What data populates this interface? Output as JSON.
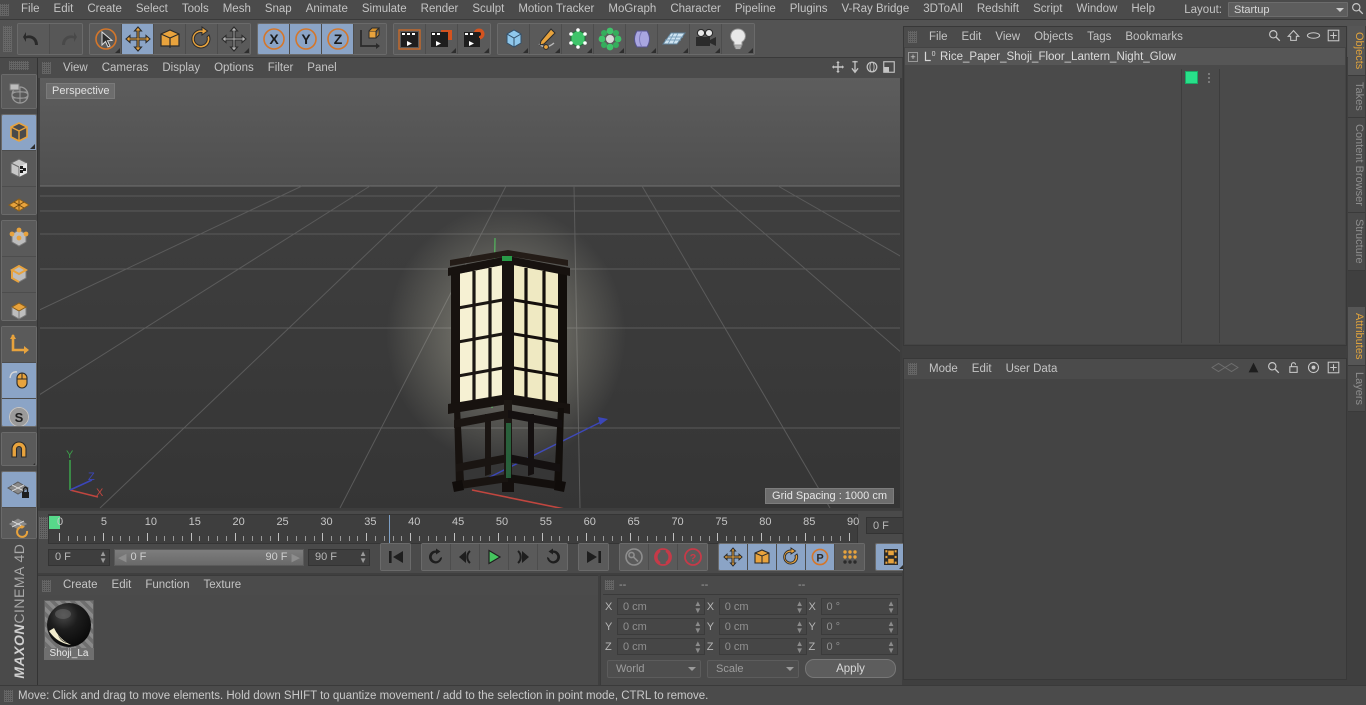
{
  "app": {
    "brand_bold": "MAXON",
    "brand_light": "CINEMA 4D"
  },
  "menubar": {
    "items": [
      "File",
      "Edit",
      "Create",
      "Select",
      "Tools",
      "Mesh",
      "Snap",
      "Animate",
      "Simulate",
      "Render",
      "Sculpt",
      "Motion Tracker",
      "MoGraph",
      "Character",
      "Pipeline",
      "Plugins",
      "V-Ray Bridge",
      "3DToAll",
      "Redshift",
      "Script",
      "Window",
      "Help"
    ],
    "layout_label": "Layout:",
    "layout_value": "Startup",
    "search_icon": "search-icon"
  },
  "toolbar": {
    "groups": [
      {
        "name": "history",
        "buttons": [
          {
            "name": "undo-button",
            "icon": "undo-arrow-icon",
            "active": false,
            "corner": false,
            "dim": false
          },
          {
            "name": "redo-button",
            "icon": "redo-arrow-icon",
            "active": false,
            "corner": false,
            "dim": true
          }
        ]
      },
      {
        "name": "transform-tools",
        "buttons": [
          {
            "name": "live-selection-tool",
            "icon": "cursor-circle-icon",
            "active": false,
            "corner": true,
            "dim": false
          },
          {
            "name": "move-tool",
            "icon": "move-arrows-icon",
            "active": true,
            "corner": false,
            "dim": false
          },
          {
            "name": "scale-tool",
            "icon": "scale-box-icon",
            "active": false,
            "corner": false,
            "dim": false
          },
          {
            "name": "rotate-tool",
            "icon": "rotate-circle-icon",
            "active": false,
            "corner": false,
            "dim": false
          },
          {
            "name": "modeling-axis-tool",
            "icon": "move-arrows-icon",
            "active": false,
            "corner": true,
            "dim": false
          }
        ]
      },
      {
        "name": "axis-locks",
        "buttons": [
          {
            "name": "x-axis-lock",
            "icon": "x-axis-icon",
            "active": true,
            "corner": false,
            "dim": false
          },
          {
            "name": "y-axis-lock",
            "icon": "y-axis-icon",
            "active": true,
            "corner": false,
            "dim": false
          },
          {
            "name": "z-axis-lock",
            "icon": "z-axis-icon",
            "active": true,
            "corner": false,
            "dim": false
          },
          {
            "name": "world-object-coordinates",
            "icon": "world-axis-cube-icon",
            "active": false,
            "corner": false,
            "dim": false
          }
        ]
      },
      {
        "name": "render-group",
        "buttons": [
          {
            "name": "render-view-button",
            "icon": "clapper-view-icon",
            "active": false,
            "corner": false,
            "dim": false
          },
          {
            "name": "render-to-picture-viewer-button",
            "icon": "clapper-picture-icon",
            "active": false,
            "corner": true,
            "dim": false
          },
          {
            "name": "render-settings-button",
            "icon": "clapper-gear-icon",
            "active": false,
            "corner": true,
            "dim": false
          }
        ]
      },
      {
        "name": "create-group",
        "buttons": [
          {
            "name": "add-cube-object",
            "icon": "blue-cube-icon",
            "active": false,
            "corner": true,
            "dim": false
          },
          {
            "name": "add-spline",
            "icon": "pen-spline-icon",
            "active": false,
            "corner": true,
            "dim": false
          },
          {
            "name": "add-generator",
            "icon": "green-cube-points-icon",
            "active": false,
            "corner": true,
            "dim": false
          },
          {
            "name": "add-mograph",
            "icon": "green-cluster-icon",
            "active": false,
            "corner": true,
            "dim": false
          },
          {
            "name": "add-deformer",
            "icon": "purple-bend-icon",
            "active": false,
            "corner": true,
            "dim": false
          },
          {
            "name": "add-environment",
            "icon": "floor-grid-icon",
            "active": false,
            "corner": true,
            "dim": false
          },
          {
            "name": "add-camera",
            "icon": "camera-icon",
            "active": false,
            "corner": true,
            "dim": false
          },
          {
            "name": "add-light",
            "icon": "lightbulb-icon",
            "active": false,
            "corner": true,
            "dim": false
          }
        ]
      }
    ]
  },
  "left_toolbar": {
    "groups": [
      {
        "name": "modeling-mode",
        "buttons": [
          {
            "name": "make-editable-button",
            "icon": "globe-wire-icon",
            "active": false,
            "corner": false
          }
        ]
      },
      {
        "name": "selection-modes",
        "buttons": [
          {
            "name": "model-mode-button",
            "icon": "model-cube-icon",
            "active": true,
            "corner": true
          },
          {
            "name": "texture-mode-button",
            "icon": "texture-cube-icon",
            "active": false,
            "corner": false
          },
          {
            "name": "workplane-mode-button",
            "icon": "workplane-icon",
            "active": false,
            "corner": false
          }
        ]
      },
      {
        "name": "component-modes",
        "buttons": [
          {
            "name": "point-mode-button",
            "icon": "point-cube-icon",
            "active": false,
            "corner": false
          },
          {
            "name": "edge-mode-button",
            "icon": "edge-cube-icon",
            "active": false,
            "corner": false
          },
          {
            "name": "polygon-mode-button",
            "icon": "polygon-cube-icon",
            "active": false,
            "corner": false
          }
        ]
      },
      {
        "name": "axis-group",
        "buttons": [
          {
            "name": "enable-axis-button",
            "icon": "axis-corner-icon",
            "active": false,
            "corner": false
          },
          {
            "name": "viewport-solo-button",
            "icon": "mouse-cursor-icon",
            "active": true,
            "corner": false
          },
          {
            "name": "soft-selection-button",
            "icon": "s-sphere-icon",
            "active": true,
            "corner": true
          }
        ]
      },
      {
        "name": "snap-group",
        "buttons": [
          {
            "name": "enable-snapping-button",
            "icon": "magnet-icon",
            "active": false,
            "corner": true
          }
        ]
      },
      {
        "name": "workplane-group",
        "buttons": [
          {
            "name": "lock-workplane-button",
            "icon": "workplane-lock-icon",
            "active": true,
            "corner": false
          },
          {
            "name": "planar-workplane-button",
            "icon": "workplane-rotate-icon",
            "active": false,
            "corner": true
          }
        ]
      }
    ]
  },
  "viewport": {
    "menu": [
      "View",
      "Cameras",
      "Display",
      "Options",
      "Filter",
      "Panel"
    ],
    "label": "Perspective",
    "grid_spacing": "Grid Spacing : 1000 cm",
    "axis_gizmo": {
      "x": "X",
      "y": "Y",
      "z": "Z",
      "x_color": "#cc4444",
      "y_color": "#44bb55",
      "z_color": "#4455cc"
    },
    "right_icons": [
      "pan-icon",
      "dolly-icon",
      "orbit-icon",
      "maximize-icon"
    ],
    "scene_object": "rice paper shoji floor lantern with warm glow"
  },
  "timeline": {
    "tick_labels": [
      "0",
      "5",
      "10",
      "15",
      "20",
      "25",
      "30",
      "35",
      "40",
      "45",
      "50",
      "55",
      "60",
      "65",
      "70",
      "75",
      "80",
      "85",
      "90"
    ],
    "start_frame": "0 F",
    "current_frame_field": "0 F",
    "range_start": "0 F",
    "range_end": "90 F",
    "end_frame": "90 F",
    "preview_frame": "0 F",
    "transport": [
      {
        "name": "go-to-start-button",
        "icon": "skip-start-icon",
        "active": false
      },
      {
        "name": "play-backwards-loop-button",
        "icon": "loop-back-icon",
        "active": false
      },
      {
        "name": "go-to-previous-frame-button",
        "icon": "step-back-icon",
        "active": false
      },
      {
        "name": "play-forward-button",
        "icon": "play-icon",
        "active": false
      },
      {
        "name": "go-to-next-frame-button",
        "icon": "step-forward-icon",
        "active": false
      },
      {
        "name": "play-forwards-loop-button",
        "icon": "loop-forward-icon",
        "active": false
      },
      {
        "name": "go-to-end-button",
        "icon": "skip-end-icon",
        "active": false
      }
    ],
    "record_group": [
      {
        "name": "autokeying-button",
        "icon": "key-icon",
        "active": false
      },
      {
        "name": "record-active-objects-button",
        "icon": "record-icon",
        "active": false
      },
      {
        "name": "keyframe-selection-button",
        "icon": "question-record-icon",
        "active": false
      }
    ],
    "key_filters": [
      {
        "name": "position-key-toggle",
        "icon": "move-arrows-icon",
        "active": true
      },
      {
        "name": "scale-key-toggle",
        "icon": "scale-box-icon",
        "active": true
      },
      {
        "name": "rotation-key-toggle",
        "icon": "rotate-circle-icon",
        "active": true
      },
      {
        "name": "parameter-key-toggle",
        "icon": "p-circle-icon",
        "active": true
      },
      {
        "name": "point-level-animation-toggle",
        "icon": "dots-grid-icon",
        "active": false
      }
    ],
    "timeline_toggle": {
      "name": "timeline-button",
      "icon": "filmstrip-icon",
      "active": true
    }
  },
  "material_manager": {
    "menu": [
      "Create",
      "Edit",
      "Function",
      "Texture"
    ],
    "materials": [
      {
        "name": "Shoji_La",
        "preview": "dark glossy sphere with cream highlight"
      }
    ]
  },
  "coordinates": {
    "headers": [
      "--",
      "--",
      "--"
    ],
    "rows": [
      {
        "label": "X",
        "position": "0 cm",
        "size": "0 cm",
        "rotation": "0 °"
      },
      {
        "label": "Y",
        "position": "0 cm",
        "size": "0 cm",
        "rotation": "0 °"
      },
      {
        "label": "Z",
        "position": "0 cm",
        "size": "0 cm",
        "rotation": "0 °"
      }
    ],
    "coord_system": "World",
    "size_mode": "Scale",
    "apply_label": "Apply"
  },
  "object_manager": {
    "menu": [
      "File",
      "Edit",
      "View",
      "Objects",
      "Tags",
      "Bookmarks"
    ],
    "right_icons": [
      "search-icon",
      "home-icon",
      "eye-icon",
      "plus-box-icon"
    ],
    "objects": [
      {
        "name": "Rice_Paper_Shoji_Floor_Lantern_Night_Glow",
        "expand": "+",
        "layer_marker": "0",
        "tag_color": "#28e08a"
      }
    ]
  },
  "attribute_manager": {
    "menu": [
      "Mode",
      "Edit",
      "User Data"
    ],
    "right_icons": [
      "history-icon",
      "arrow-up-icon",
      "search-icon",
      "lock-icon",
      "target-icon",
      "plus-box-icon"
    ]
  },
  "right_tabs_top": [
    {
      "label": "Objects",
      "active": true
    },
    {
      "label": "Takes",
      "active": false
    },
    {
      "label": "Content Browser",
      "active": false
    },
    {
      "label": "Structure",
      "active": false
    }
  ],
  "right_tabs_bottom": [
    {
      "label": "Attributes",
      "active": true
    },
    {
      "label": "Layers",
      "active": false
    }
  ],
  "statusbar": {
    "text": "Move: Click and drag to move elements. Hold down SHIFT to quantize movement / add to the selection in point mode, CTRL to remove."
  }
}
